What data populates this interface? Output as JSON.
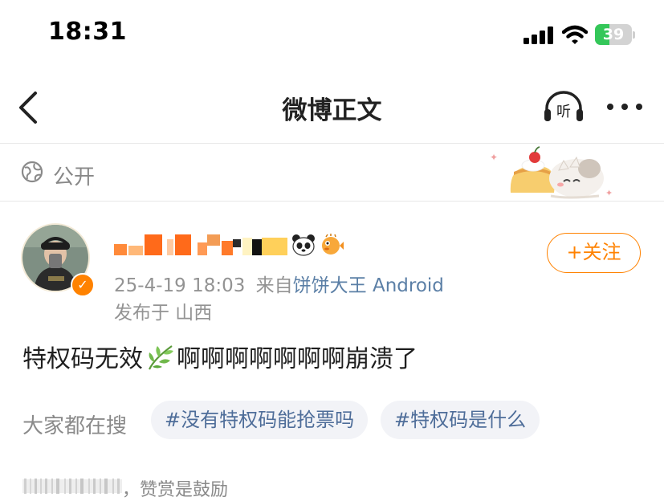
{
  "status_bar": {
    "time": "18:31",
    "battery_level": "39",
    "battery_fraction": 0.39
  },
  "nav": {
    "title": "微博正文",
    "listen_label": "听"
  },
  "visibility": {
    "label": "公开"
  },
  "post": {
    "timestamp": "25-4-19 18:03",
    "source_prefix": "来自",
    "source": "饼饼大王 Android",
    "location": "发布于 山西",
    "follow_label": "+关注",
    "content_before": "特权码无效",
    "content_after": "啊啊啊啊啊啊啊崩溃了"
  },
  "search": {
    "label": "大家都在搜",
    "tags": [
      "#没有特权码能抢票吗",
      "#特权码是什么"
    ]
  },
  "reward": {
    "text": "，赞赏是鼓励"
  },
  "colors": {
    "accent": "#ff8200",
    "link": "#5b7fa6",
    "tag_text": "#4e6d99",
    "battery": "#34c759"
  },
  "icons": [
    "back-chevron-icon",
    "listen-icon",
    "more-icon",
    "globe-icon",
    "verified-badge-icon",
    "panda-emoji-icon",
    "pufferfish-emoji-icon",
    "leaf-emoji-icon"
  ]
}
